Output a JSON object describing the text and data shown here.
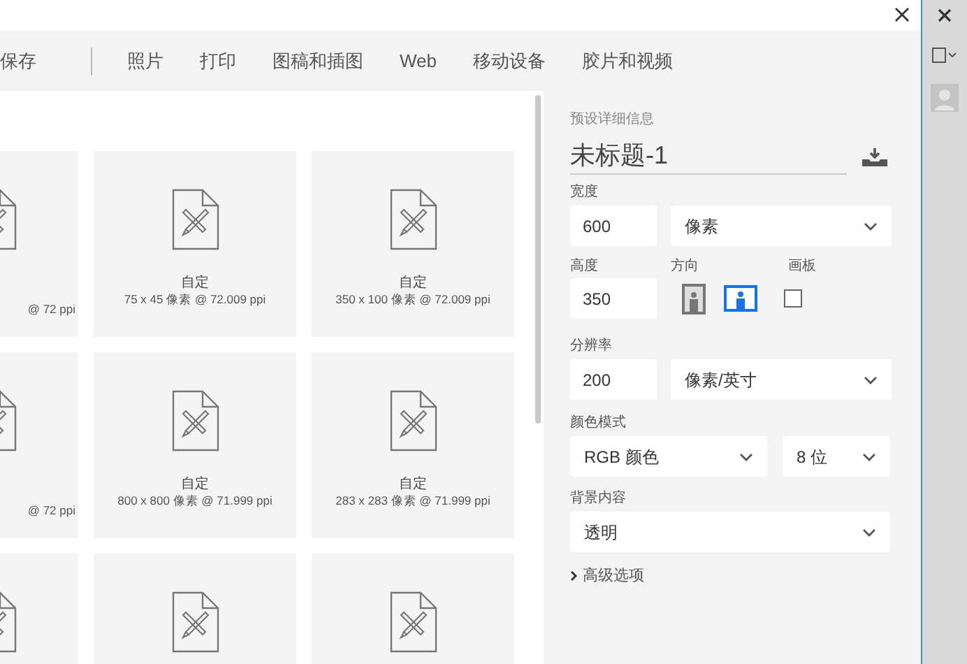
{
  "tabs": [
    {
      "label": "保存",
      "selected": false
    },
    {
      "label": "照片",
      "selected": false
    },
    {
      "label": "打印",
      "selected": false
    },
    {
      "label": "图稿和插图",
      "selected": false
    },
    {
      "label": "Web",
      "selected": false
    },
    {
      "label": "移动设备",
      "selected": false
    },
    {
      "label": "胶片和视频",
      "selected": false
    }
  ],
  "presets": [
    [
      {
        "kind": "cut",
        "subtitle": "@ 72 ppi"
      },
      {
        "kind": "full",
        "title": "自定",
        "subtitle": "75 x 45 像素 @ 72.009 ppi"
      },
      {
        "kind": "full",
        "title": "自定",
        "subtitle": "350 x 100 像素 @ 72.009 ppi"
      }
    ],
    [
      {
        "kind": "cut",
        "subtitle": "@ 72 ppi"
      },
      {
        "kind": "full",
        "title": "自定",
        "subtitle": "800 x 800 像素 @ 71.999 ppi"
      },
      {
        "kind": "full",
        "title": "自定",
        "subtitle": "283 x 283 像素 @ 71.999 ppi"
      }
    ],
    [
      {
        "kind": "cut"
      },
      {
        "kind": "full"
      },
      {
        "kind": "full"
      }
    ]
  ],
  "details": {
    "heading": "预设详细信息",
    "name": "未标题-1",
    "width": {
      "label": "宽度",
      "value": "600",
      "unit": "像素"
    },
    "height": {
      "label": "高度",
      "value": "350"
    },
    "orientation": {
      "label": "方向",
      "options": [
        {
          "kind": "portrait",
          "selected": false
        },
        {
          "kind": "landscape",
          "selected": true
        }
      ]
    },
    "artboard": {
      "label": "画板",
      "checked": false
    },
    "resolution": {
      "label": "分辨率",
      "value": "200",
      "unit": "像素/英寸"
    },
    "color_mode": {
      "label": "颜色模式",
      "mode": "RGB 颜色",
      "depth": "8 位"
    },
    "background": {
      "label": "背景内容",
      "value": "透明"
    },
    "advanced": {
      "label": "高级选项",
      "expanded": false
    }
  }
}
